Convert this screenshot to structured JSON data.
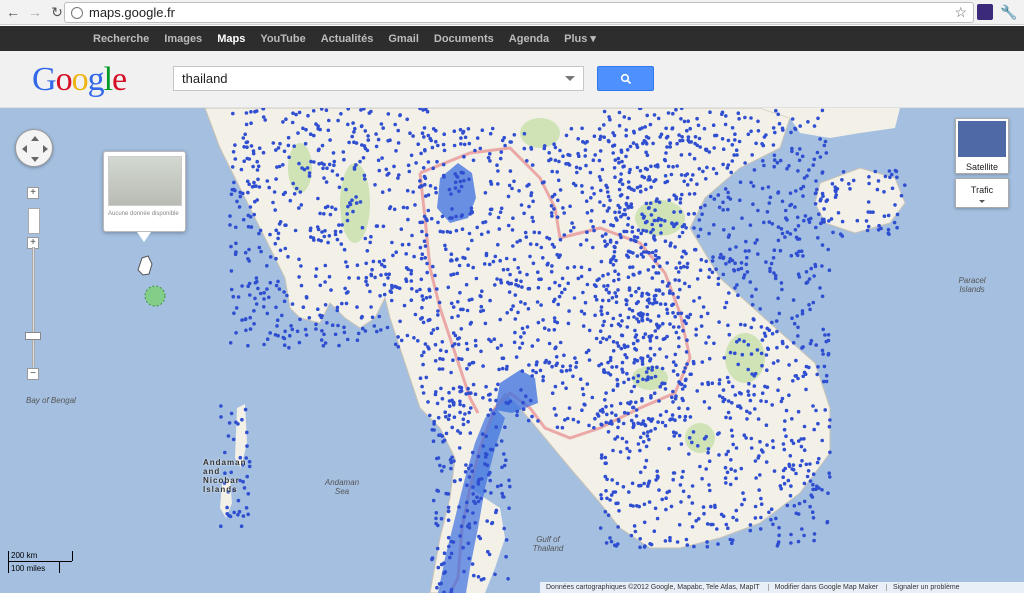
{
  "browser": {
    "url": "maps.google.fr",
    "back_icon": "back-arrow-icon",
    "forward_icon": "forward-arrow-icon",
    "reload_icon": "reload-icon",
    "star_icon": "star-icon",
    "wrench_icon": "wrench-icon"
  },
  "gbar": {
    "items": [
      "Recherche",
      "Images",
      "Maps",
      "YouTube",
      "Actualités",
      "Gmail",
      "Documents",
      "Agenda",
      "Plus ▾"
    ],
    "active": "Maps"
  },
  "header": {
    "logo_letters": [
      "G",
      "o",
      "o",
      "g",
      "l",
      "e"
    ],
    "logo_colors": [
      "#3369e8",
      "#d50f25",
      "#eeb211",
      "#3369e8",
      "#009925",
      "#d50f25"
    ],
    "search_value": "thailand",
    "search_button_icon": "magnifier-icon",
    "accent": "#4d90fe"
  },
  "map": {
    "labels": {
      "bay_of_bengal": "Bay of Bengal",
      "andaman_sea": "Andaman Sea",
      "gulf_of_thailand": "Gulf of Thailand",
      "paracel": "Paracel Islands",
      "andaman_islands": "Andaman and Nicobar Islands"
    },
    "info_card_text": "Aucune donnée disponible",
    "controls": {
      "zoom_in": "+",
      "zoom_out": "−",
      "satellite": "Satellite",
      "traffic": "Trafic"
    },
    "scale": {
      "km": "200 km",
      "miles": "100 miles"
    },
    "copyright": {
      "data": "Données cartographiques ©2012 Google, Mapabc, Tele Atlas, MapIT",
      "map_maker": "Modifier dans Google Map Maker",
      "report": "Signaler un problème"
    },
    "colors": {
      "water": "#a4bfe0",
      "land": "#f3f0e8",
      "forest": "#cfe3b6",
      "border": "#e9a0a0",
      "dot": "#2f4fd0",
      "highlight": "#3a6fe0"
    }
  }
}
